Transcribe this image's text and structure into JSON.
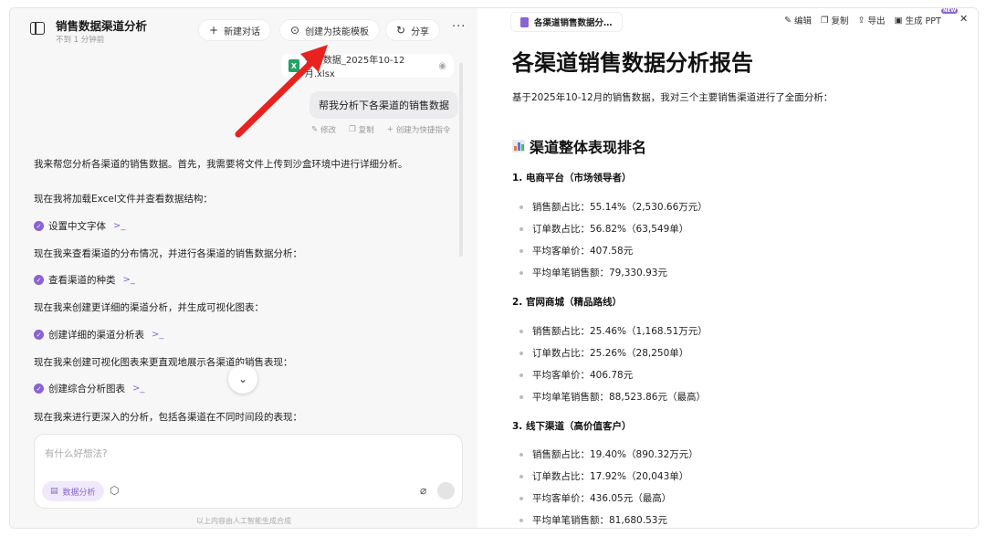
{
  "conversation": {
    "title": "销售数据渠道分析",
    "subtitle": "不到 1 分钟前",
    "actions": {
      "new_chat": "新建对话",
      "create_template": "创建为技能模板",
      "share": "分享",
      "more": "···"
    },
    "file": {
      "name": "销售数据_2025年10-12月.xlsx",
      "type_badge": "X"
    },
    "user_message": "帮我分析下各渠道的销售数据",
    "message_actions": {
      "edit": "修改",
      "copy": "复制",
      "shortcut": "创建为快捷指令"
    },
    "ai_intro": "我来帮您分析各渠道的销售数据。首先，我需要将文件上传到沙盒环境中进行详细分析。",
    "steps": [
      {
        "text": "现在我将加载Excel文件并查看数据结构：",
        "tool": "设置中文字体"
      },
      {
        "text": "现在我来查看渠道的分布情况，并进行各渠道的销售数据分析：",
        "tool": "查看渠道的种类"
      },
      {
        "text": "现在我来创建更详细的渠道分析，并生成可视化图表：",
        "tool": "创建详细的渠道分析表"
      },
      {
        "text": "现在我来创建可视化图表来更直观地展示各渠道的销售表现：",
        "tool": "创建综合分析图表"
      }
    ],
    "last_text": "现在我来进行更深入的分析，包括各渠道在不同时间段的表现：",
    "input": {
      "placeholder": "有什么好想法?",
      "mode_label": "数据分析"
    },
    "disclaimer": "以上内容由人工智能生成合成"
  },
  "document": {
    "tab_title": "各渠道销售数据分…",
    "actions": {
      "edit": "编辑",
      "copy": "复制",
      "export": "导出",
      "ppt": "生成 PPT",
      "new_badge": "NEW"
    },
    "title": "各渠道销售数据分析报告",
    "intro": "基于2025年10-12月的销售数据，我对三个主要销售渠道进行了全面分析：",
    "section_title": "渠道整体表现排名",
    "channels": [
      {
        "heading": "1. 电商平台（市场领导者）",
        "items": [
          "销售额占比：55.14%（2,530.66万元）",
          "订单数占比：56.82%（63,549单）",
          "平均客单价：407.58元",
          "平均单笔销售额：79,330.93元"
        ]
      },
      {
        "heading": "2. 官网商城（精品路线）",
        "items": [
          "销售额占比：25.46%（1,168.51万元）",
          "订单数占比：25.26%（28,250单）",
          "平均客单价：406.78元",
          "平均单笔销售额：88,523.86元（最高）"
        ]
      },
      {
        "heading": "3. 线下渠道（高价值客户）",
        "items": [
          "销售额占比：19.40%（890.32万元）",
          "订单数占比：17.92%（20,043单）",
          "平均客单价：436.05元（最高）",
          "平均单笔销售额：81,680.53元"
        ]
      }
    ]
  },
  "colors": {
    "accent": "#8a63d2",
    "annotation_arrow": "#e8231f",
    "excel": "#21a366"
  }
}
